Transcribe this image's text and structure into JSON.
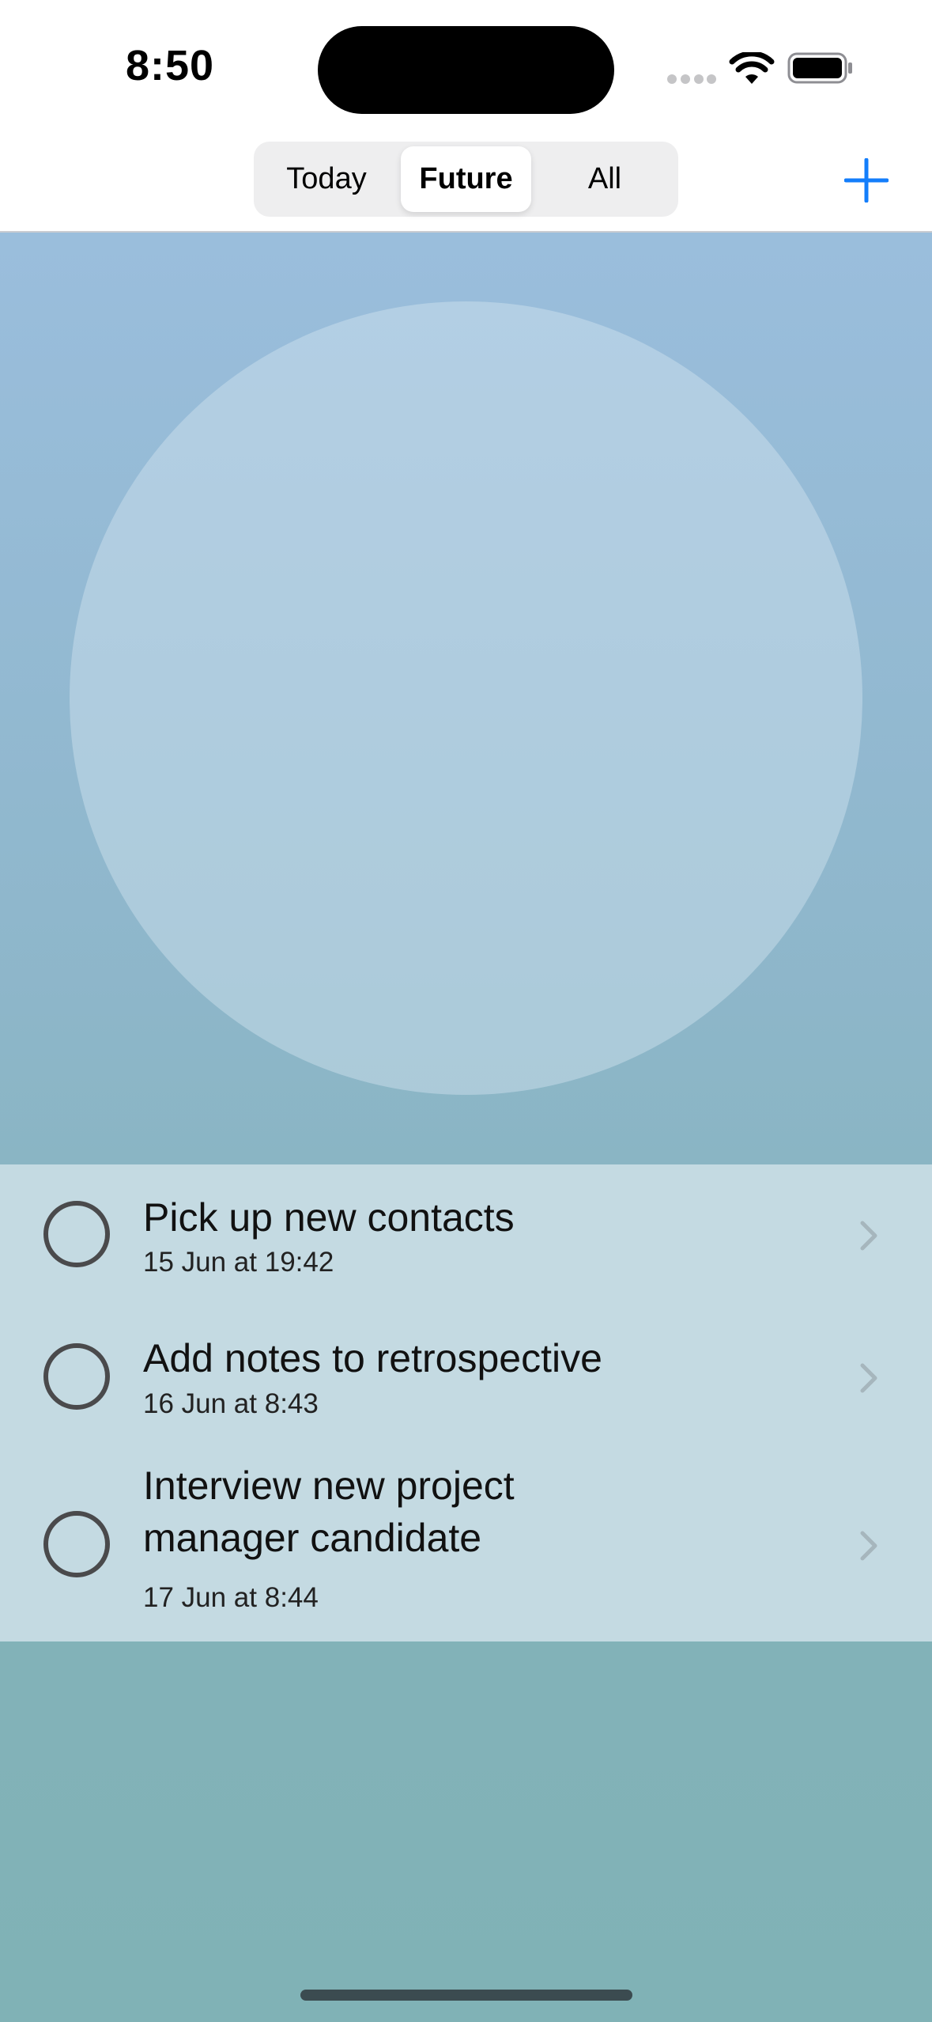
{
  "status_bar": {
    "time": "8:50",
    "icons": [
      "signal-dots-icon",
      "wifi-icon",
      "battery-icon"
    ]
  },
  "nav": {
    "segments": [
      "Today",
      "Future",
      "All"
    ],
    "selected_segment": "Future",
    "add_icon": "plus-icon",
    "accent_color": "#147efb"
  },
  "tasks": [
    {
      "title": "Pick up new contacts",
      "date": "15 Jun at 19:42",
      "completed": false
    },
    {
      "title": "Add notes to retrospective",
      "date": "16 Jun at 8:43",
      "completed": false
    },
    {
      "title": "Interview new project manager candidate",
      "date": "17 Jun at 8:44",
      "completed": false
    }
  ]
}
